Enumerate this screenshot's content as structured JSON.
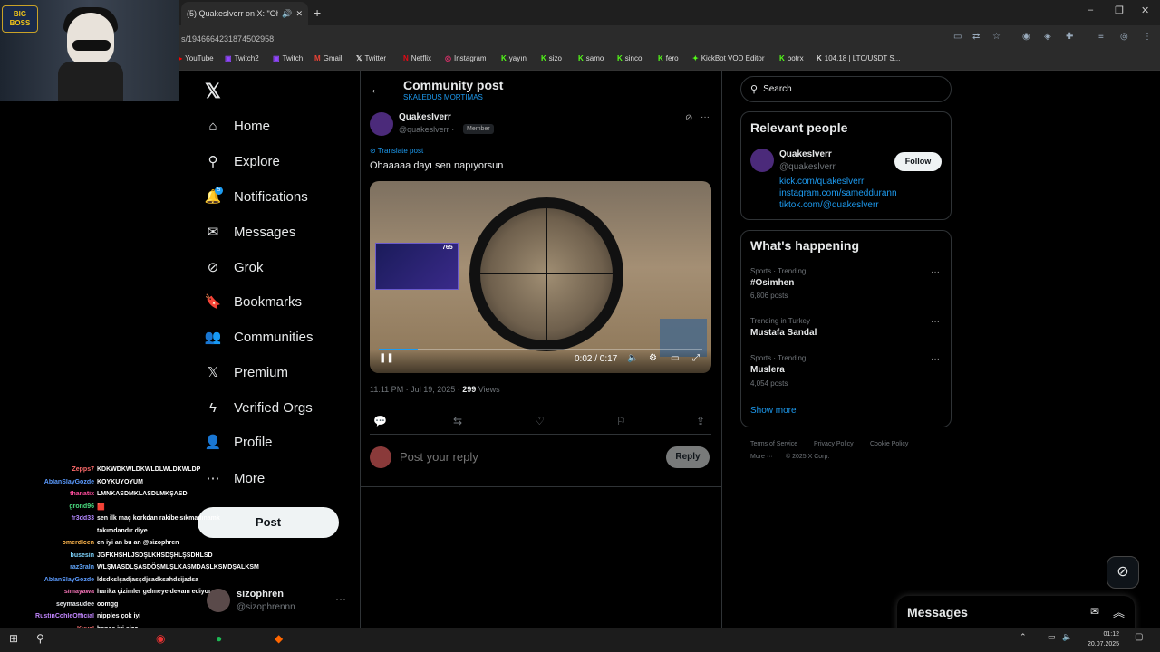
{
  "browser": {
    "tab_title": "(5) QuakesIverr on X: \"Oha...",
    "new_tab": "+",
    "url": "s/1946664231874502958",
    "window_buttons": [
      "–",
      "❐",
      "✕"
    ],
    "bookmarks": [
      "YouTube",
      "Twitch2",
      "Twitch",
      "Gmail",
      "Twitter",
      "Netflix",
      "Instagram",
      "yayın",
      "sizo",
      "samo",
      "sinco",
      "fero",
      "KickBot VOD Editor",
      "botrx",
      "104.18 | LTC/USDT S..."
    ]
  },
  "webcam": {
    "badge": "BIG BOSS"
  },
  "chat": [
    {
      "user": "Zepps7",
      "color": "#ff6b6b",
      "msg": "KDKWDKWLDKWLDLWLDKWLDP"
    },
    {
      "user": "AblanSlayGozde",
      "color": "#5b9bff",
      "msg": "KOYKUYOYUM"
    },
    {
      "user": "thanatix",
      "color": "#ff4d9d",
      "msg": "LMNKASDMKLASDLMKŞASD"
    },
    {
      "user": "grond96",
      "color": "#4ade80",
      "msg": "🟥"
    },
    {
      "user": "fr3dd33",
      "color": "#b388ff",
      "msg": "sen ilk maç korkdan rakibe sıkmadınamk"
    },
    {
      "user": "",
      "color": "#fff",
      "msg": "takımdandır diye"
    },
    {
      "user": "omerdlcen",
      "color": "#ffb74d",
      "msg": "en iyi an bu an @sizophren"
    },
    {
      "user": "busesin",
      "color": "#7dd3fc",
      "msg": "JGFKHSHLJSDŞLKHSDŞHLŞSDHLSD"
    },
    {
      "user": "raz3raln",
      "color": "#60a5fa",
      "msg": "WLŞMASDLŞASDÖŞMLŞLKASMDAŞLKSMDŞALKSM"
    },
    {
      "user": "AblanSlayGozde",
      "color": "#5b9bff",
      "msg": "ldsdkslşadjasşdjsadksahdsijadsa"
    },
    {
      "user": "simayawa",
      "color": "#f472b6",
      "msg": "harika çizimler gelmeye devam ediyor"
    },
    {
      "user": "seymasudee",
      "color": "#e5e7eb",
      "msg": "oomgg"
    },
    {
      "user": "RustinCohleOfficial",
      "color": "#c084fc",
      "msg": "nipples çok iyi"
    },
    {
      "user": "Kuval",
      "color": "#f87171",
      "msg": "bence iyi sizo"
    },
    {
      "user": "Zepps7",
      "color": "#ff6b6b",
      "msg": "Bu ne KSMWKSLWLSLWLLWLDLWLDLWE"
    }
  ],
  "nav": {
    "items": [
      {
        "label": "Home",
        "icon": "home-icon",
        "glyph": "⌂"
      },
      {
        "label": "Explore",
        "icon": "search-icon",
        "glyph": "⚲"
      },
      {
        "label": "Notifications",
        "icon": "bell-icon",
        "glyph": "🔔"
      },
      {
        "label": "Messages",
        "icon": "mail-icon",
        "glyph": "✉"
      },
      {
        "label": "Grok",
        "icon": "grok-icon",
        "glyph": "⊘"
      },
      {
        "label": "Bookmarks",
        "icon": "bookmark-icon",
        "glyph": "🔖"
      },
      {
        "label": "Communities",
        "icon": "people-icon",
        "glyph": "👥"
      },
      {
        "label": "Premium",
        "icon": "x-premium-icon",
        "glyph": "𝕏"
      },
      {
        "label": "Verified Orgs",
        "icon": "lightning-icon",
        "glyph": "ϟ"
      },
      {
        "label": "Profile",
        "icon": "person-icon",
        "glyph": "👤"
      },
      {
        "label": "More",
        "icon": "more-circle-icon",
        "glyph": "⋯"
      }
    ],
    "notif_count": "5",
    "post_label": "Post",
    "account": {
      "name": "sizophren",
      "handle": "@sizophrennn"
    }
  },
  "header": {
    "title": "Community post",
    "subtitle": "SKALEDUS MORTIMAS"
  },
  "post": {
    "author": "QuakesIverr",
    "handle": "@quakeslverr",
    "separator": "·",
    "badge": "Member",
    "translate": "Translate post",
    "text": "Ohaaaaa dayı sen napıyorsun",
    "video": {
      "time": "0:02 / 0:17",
      "facecam_number": "765",
      "progress": 0.12
    },
    "timestamp": "11:11 PM · Jul 19, 2025 · ",
    "views": "299",
    "views_label": " Views"
  },
  "reply": {
    "placeholder": "Post your reply",
    "button": "Reply"
  },
  "search": {
    "placeholder": "Search"
  },
  "relevant": {
    "title": "Relevant people",
    "name": "QuakesIverr",
    "handle": "@quakeslverr",
    "follow": "Follow",
    "links": [
      "kick.com/quakeslverr",
      "instagram.com/sameddurann",
      "tiktok.com/@quakeslverr"
    ]
  },
  "happening": {
    "title": "What's happening",
    "trends": [
      {
        "context": "Sports · Trending",
        "name": "#Osimhen",
        "count": "6,806 posts"
      },
      {
        "context": "Trending in Turkey",
        "name": "Mustafa Sandal",
        "count": ""
      },
      {
        "context": "Sports · Trending",
        "name": "Muslera",
        "count": "4,054 posts"
      }
    ],
    "show_more": "Show more"
  },
  "footer": {
    "links": [
      "Terms of Service",
      "Privacy Policy",
      "Cookie Policy"
    ],
    "more": "More ···",
    "copyright": "© 2025 X Corp."
  },
  "messages": {
    "title": "Messages"
  },
  "taskbar": {
    "time": "01:12",
    "date": "20.07.2025"
  },
  "colors": {
    "accent": "#1d9bf0",
    "bg": "#000000",
    "border": "#2f3336"
  }
}
